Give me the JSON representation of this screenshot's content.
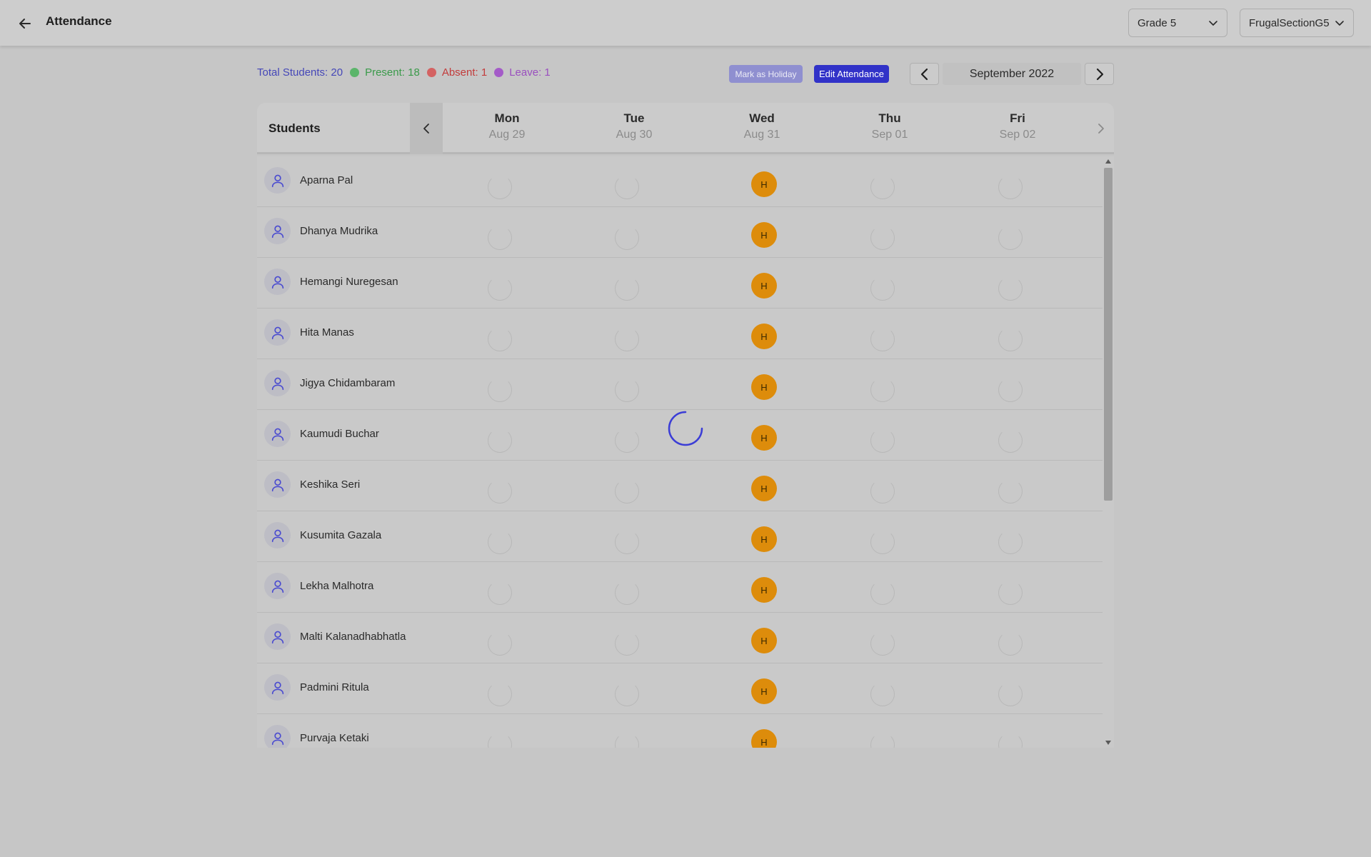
{
  "header": {
    "title": "Attendance",
    "grade_select": {
      "value": "Grade 5"
    },
    "section_select": {
      "value": "FrugalSectionG5"
    }
  },
  "summary": {
    "total": "Total Students: 20",
    "present": "Present: 18",
    "absent": "Absent: 1",
    "leave": "Leave: 1",
    "colors": {
      "total": "#4547b8",
      "present": "#3a9a4a",
      "absent": "#c23b3b",
      "leave": "#9a4fbf"
    }
  },
  "actions": {
    "mark_holiday": "Mark as Holiday",
    "edit_attendance": "Edit Attendance"
  },
  "month": {
    "label": "September 2022"
  },
  "table": {
    "students_header": "Students",
    "days": [
      {
        "name": "Mon",
        "date": "Aug 29"
      },
      {
        "name": "Tue",
        "date": "Aug 30"
      },
      {
        "name": "Wed",
        "date": "Aug 31"
      },
      {
        "name": "Thu",
        "date": "Sep 01"
      },
      {
        "name": "Fri",
        "date": "Sep 02"
      }
    ],
    "holiday_badge": "H",
    "holiday_color": "#dd8c0b",
    "students": [
      {
        "name": "Aparna Pal",
        "marks": [
          "",
          "",
          "H",
          "",
          ""
        ]
      },
      {
        "name": "Dhanya Mudrika",
        "marks": [
          "",
          "",
          "H",
          "",
          ""
        ]
      },
      {
        "name": "Hemangi Nuregesan",
        "marks": [
          "",
          "",
          "H",
          "",
          ""
        ]
      },
      {
        "name": "Hita Manas",
        "marks": [
          "",
          "",
          "H",
          "",
          ""
        ]
      },
      {
        "name": "Jigya Chidambaram",
        "marks": [
          "",
          "",
          "H",
          "",
          ""
        ]
      },
      {
        "name": "Kaumudi Buchar",
        "marks": [
          "",
          "",
          "H",
          "",
          ""
        ]
      },
      {
        "name": "Keshika Seri",
        "marks": [
          "",
          "",
          "H",
          "",
          ""
        ]
      },
      {
        "name": "Kusumita Gazala",
        "marks": [
          "",
          "",
          "H",
          "",
          ""
        ]
      },
      {
        "name": "Lekha Malhotra",
        "marks": [
          "",
          "",
          "H",
          "",
          ""
        ]
      },
      {
        "name": "Malti Kalanadhabhatla",
        "marks": [
          "",
          "",
          "H",
          "",
          ""
        ]
      },
      {
        "name": "Padmini Ritula",
        "marks": [
          "",
          "",
          "H",
          "",
          ""
        ]
      },
      {
        "name": "Purvaja Ketaki",
        "marks": [
          "",
          "",
          "H",
          "",
          ""
        ]
      }
    ]
  },
  "icons": {
    "back": "arrow-left-icon",
    "dropdown": "chevron-down-icon",
    "prev": "chevron-left-icon",
    "next": "chevron-right-icon",
    "avatar": "user-icon",
    "loading": "spinner-icon"
  }
}
